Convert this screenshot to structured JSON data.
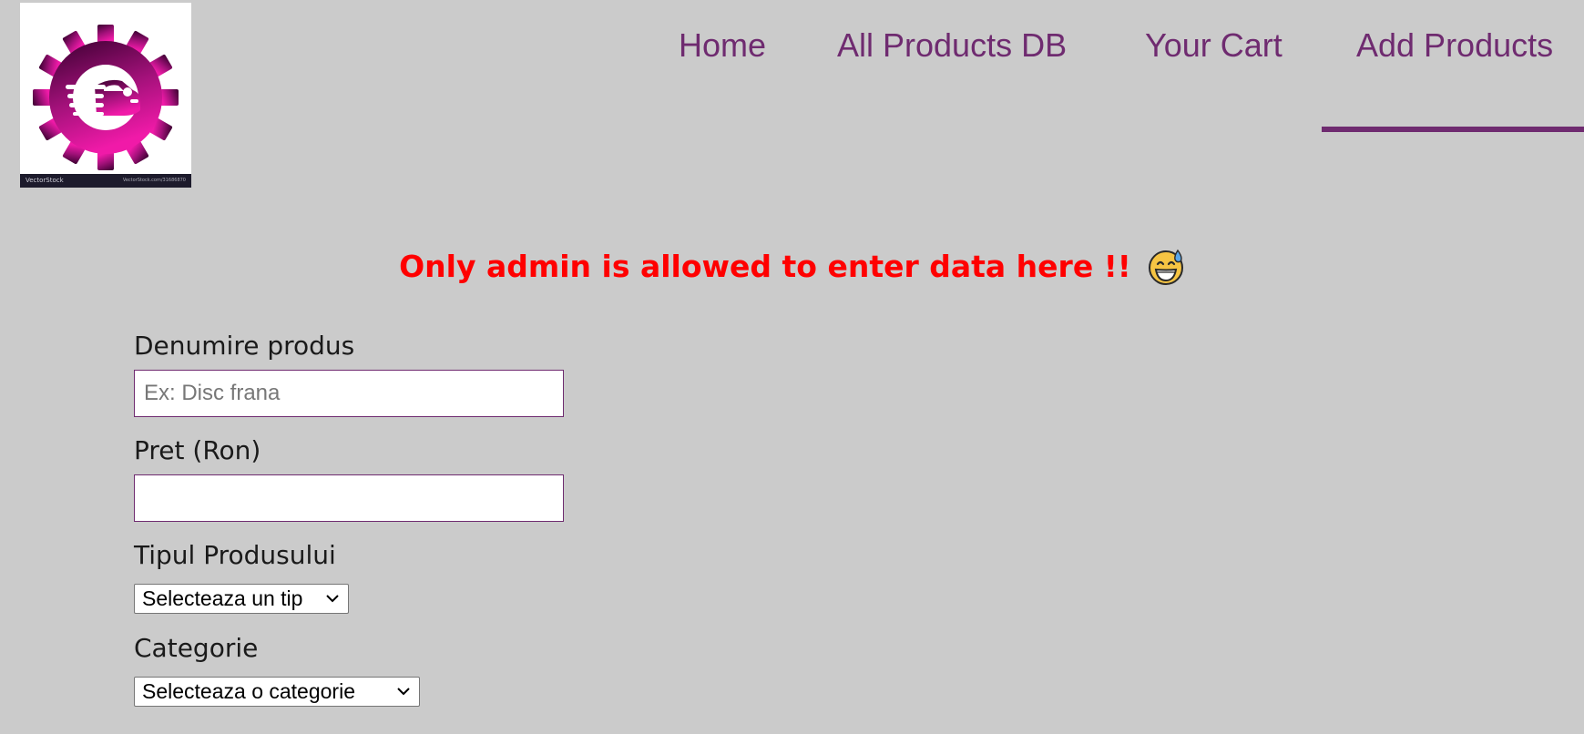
{
  "logo": {
    "brand_left": "VectorStock",
    "brand_right": "VectorStock.com/31686870",
    "icon": "gear-car-logo-icon",
    "colors": {
      "dark": "#3a0030",
      "light": "#f01aa8"
    }
  },
  "nav": {
    "items": [
      {
        "label": "Home"
      },
      {
        "label": "All Products DB"
      },
      {
        "label": "Your Cart"
      },
      {
        "label": "Add Products",
        "active": true
      }
    ],
    "color": "#6f2b70"
  },
  "warning": {
    "text": "Only admin is allowed to enter data here !!",
    "icon": "grinning-sweat-emoji-icon",
    "color": "#ff0000"
  },
  "form": {
    "name": {
      "label": "Denumire produs",
      "placeholder": "Ex: Disc frana",
      "value": ""
    },
    "price": {
      "label": "Pret (Ron)",
      "placeholder": "",
      "value": ""
    },
    "type": {
      "label": "Tipul Produsului",
      "selected": "Selecteaza un tip"
    },
    "category": {
      "label": "Categorie",
      "selected": "Selecteaza o categorie"
    }
  },
  "colors": {
    "background": "#cbcbcb",
    "accent": "#6f2b70",
    "warning": "#ff0000"
  }
}
